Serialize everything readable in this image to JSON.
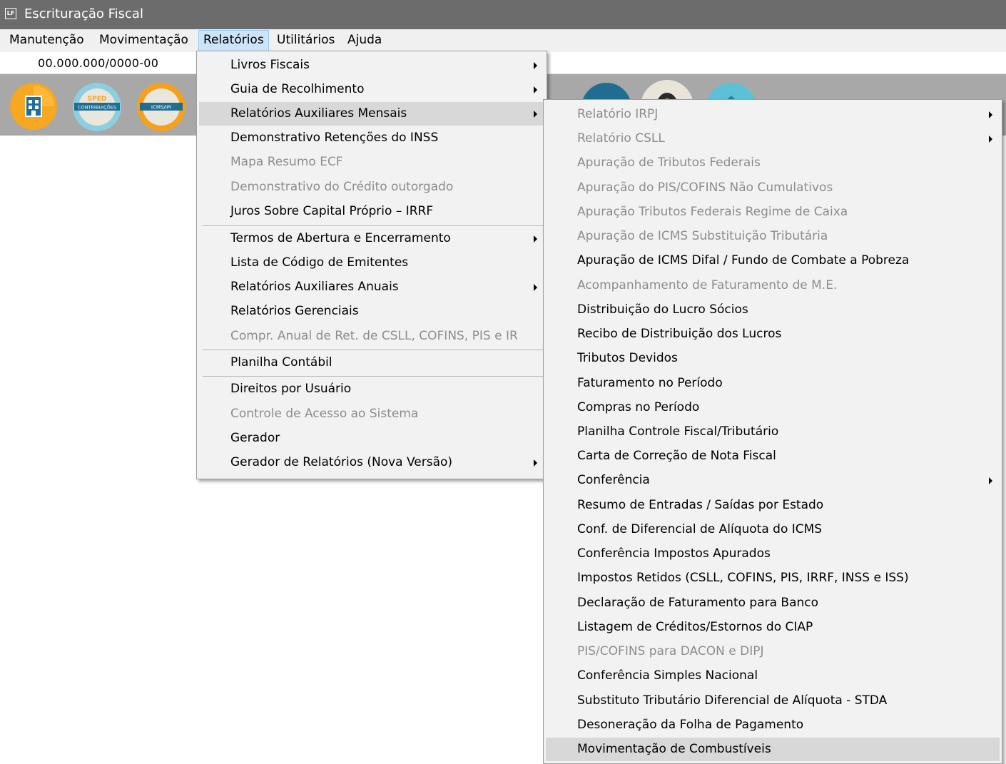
{
  "window": {
    "title": "Escrituração Fiscal",
    "app_icon_text": "LF"
  },
  "menubar": {
    "items": [
      {
        "label": "Manutenção"
      },
      {
        "label": "Movimentação"
      },
      {
        "label": "Relatórios"
      },
      {
        "label": "Utilitários"
      },
      {
        "label": "Ajuda"
      }
    ]
  },
  "company": {
    "cnpj": "00.000.000/0000-00"
  },
  "toolbar": {
    "icons": [
      {
        "name": "company-building-icon"
      },
      {
        "name": "sped-contribuicoes-icon",
        "text_top": "SPED",
        "text_band": "CONTRIBUIÇÕES"
      },
      {
        "name": "icms-ipi-icon",
        "text_band": "ICMS/IPI"
      }
    ]
  },
  "relatorios_menu": {
    "items": [
      {
        "label": "Livros Fiscais"
      },
      {
        "label": "Guia de Recolhimento"
      },
      {
        "label": "Relatórios Auxiliares Mensais"
      },
      {
        "label": "Demonstrativo Retenções do INSS"
      },
      {
        "label": "Mapa Resumo ECF"
      },
      {
        "label": "Demonstrativo do Crédito outorgado"
      },
      {
        "label": "Juros Sobre Capital Próprio – IRRF"
      },
      {
        "label": "Termos de Abertura e Encerramento"
      },
      {
        "label": "Lista de Código de Emitentes"
      },
      {
        "label": "Relatórios Auxiliares Anuais"
      },
      {
        "label": "Relatórios Gerenciais"
      },
      {
        "label": "Compr. Anual de Ret. de CSLL, COFINS,  PIS e IR"
      },
      {
        "label": "Planilha Contábil"
      },
      {
        "label": "Direitos por Usuário"
      },
      {
        "label": "Controle de Acesso ao Sistema"
      },
      {
        "label": "Gerador"
      },
      {
        "label": "Gerador de Relatórios (Nova Versão)"
      }
    ]
  },
  "submenu_mensais": {
    "items": [
      {
        "label": "Relatório IRPJ"
      },
      {
        "label": "Relatório CSLL"
      },
      {
        "label": "Apuração de Tributos Federais"
      },
      {
        "label": "Apuração do PIS/COFINS Não Cumulativos"
      },
      {
        "label": "Apuração Tributos Federais Regime de Caixa"
      },
      {
        "label": "Apuração de ICMS Substituição Tributária"
      },
      {
        "label": "Apuração de ICMS Difal / Fundo de Combate a Pobreza"
      },
      {
        "label": "Acompanhamento de Faturamento de M.E."
      },
      {
        "label": "Distribuição do Lucro Sócios"
      },
      {
        "label": "Recibo de Distribuição dos Lucros"
      },
      {
        "label": "Tributos Devidos"
      },
      {
        "label": "Faturamento no Período"
      },
      {
        "label": "Compras no Período"
      },
      {
        "label": "Planilha Controle Fiscal/Tributário"
      },
      {
        "label": "Carta de Correção de Nota Fiscal"
      },
      {
        "label": "Conferência"
      },
      {
        "label": "Resumo de Entradas / Saídas por Estado"
      },
      {
        "label": "Conf. de Diferencial de Alíquota do ICMS"
      },
      {
        "label": "Conferência Impostos Apurados"
      },
      {
        "label": "Impostos Retidos (CSLL, COFINS,  PIS, IRRF, INSS e ISS)"
      },
      {
        "label": "Declaração de Faturamento para Banco"
      },
      {
        "label": "Listagem de Créditos/Estornos do CIAP"
      },
      {
        "label": "PIS/COFINS para DACON e DIPJ"
      },
      {
        "label": "Conferência Simples Nacional"
      },
      {
        "label": "Substituto Tributário Diferencial de Alíquota - STDA"
      },
      {
        "label": "Desoneração da Folha de Pagamento"
      },
      {
        "label": "Movimentação de Combustíveis"
      }
    ]
  }
}
